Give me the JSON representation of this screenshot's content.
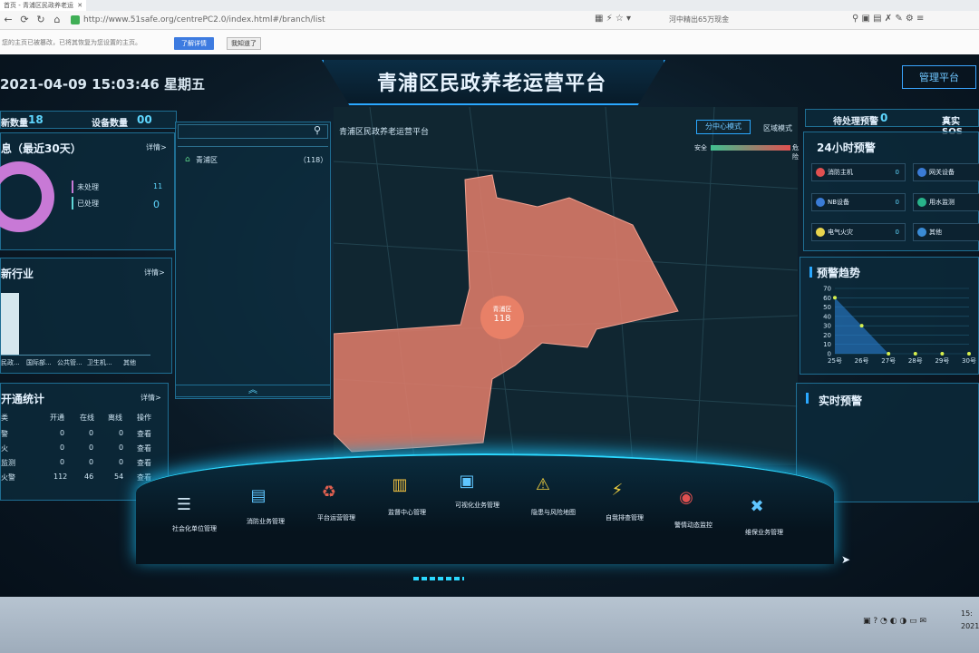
{
  "browser": {
    "tab_title": "首页 - 青浦区民政养老运",
    "tab_close": "✕",
    "url": "http://www.51safe.org/centrePC2.0/index.html#/branch/list",
    "side_search": "河中精出65万现金",
    "notification": "您的主页已被篡改，已将其恢复为您设置的主页。",
    "btn_know": "了解详情",
    "btn_ok": "我知道了"
  },
  "header": {
    "datetime": "2021-04-09 15:03:46 星期五",
    "title": "青浦区民政养老运营平台",
    "mgmt_button": "管理平台"
  },
  "left": {
    "top_stats": {
      "label1": "新数量",
      "value1": "18",
      "label2": "设备数量",
      "value2": "00"
    },
    "alarm_panel": {
      "title": "息（最近30天）",
      "more": "详情>",
      "legend": [
        {
          "label": "未处理",
          "value": "11",
          "color": "#c879d6"
        },
        {
          "label": "已处理",
          "value": "0",
          "color": "#5fd7d7"
        }
      ]
    },
    "industry_panel": {
      "title": "新行业",
      "more": "详情>",
      "categories": [
        "民政...",
        "国际部...",
        "公共管...",
        "卫生机...",
        "其他"
      ]
    },
    "open_panel": {
      "title": "开通统计",
      "more": "详情>",
      "headers": [
        "类",
        "开通",
        "在线",
        "离线",
        "操作"
      ],
      "rows": [
        {
          "name": "警",
          "open": "0",
          "online": "0",
          "offline": "0",
          "op": "查看"
        },
        {
          "name": "火",
          "open": "0",
          "online": "0",
          "offline": "0",
          "op": "查看"
        },
        {
          "name": "监测",
          "open": "0",
          "online": "0",
          "offline": "0",
          "op": "查看"
        },
        {
          "name": "火警",
          "open": "112",
          "online": "46",
          "offline": "54",
          "op": "查看"
        }
      ]
    }
  },
  "search_panel": {
    "placeholder": "",
    "region": "青浦区",
    "count": "（118）"
  },
  "map": {
    "subtitle": "青浦区民政养老运营平台",
    "mode1": "分中心模式",
    "mode2": "区域模式",
    "safe_label": "安全",
    "danger_label": "危险",
    "district_label": "青浦区",
    "district_value": "118"
  },
  "right": {
    "pending_label": "待处理预警",
    "pending_value": "0",
    "realtime_sos": "真实SOS",
    "alert24_title": "24小时预警",
    "alerts": [
      {
        "label": "消防主机",
        "value": "0",
        "color": "#e05050"
      },
      {
        "label": "网关设备",
        "value": "",
        "color": "#3a7bd5"
      },
      {
        "label": "NB设备",
        "value": "0",
        "color": "#3a7bd5"
      },
      {
        "label": "用水监测",
        "value": "",
        "color": "#28b38a"
      },
      {
        "label": "电气火灾",
        "value": "0",
        "color": "#e8d44d"
      },
      {
        "label": "其他",
        "value": "",
        "color": "#3a8bd5"
      }
    ],
    "trend_title": "预警趋势",
    "realtime_title": "实时预警"
  },
  "chart_data": {
    "type": "area",
    "title": "预警趋势",
    "x": [
      "25号",
      "26号",
      "27号",
      "28号",
      "29号",
      "30号"
    ],
    "y_ticks": [
      0,
      10,
      20,
      30,
      40,
      50,
      60,
      70
    ],
    "values": [
      60,
      30,
      0,
      0,
      0,
      0
    ],
    "ylim": [
      0,
      70
    ],
    "color": "#2a7fd0"
  },
  "bottom_nav": [
    {
      "label": "社会化单位管理",
      "icon": "stack-icon"
    },
    {
      "label": "消防业务管理",
      "icon": "document-icon"
    },
    {
      "label": "平台运营管理",
      "icon": "cycle-icon"
    },
    {
      "label": "监督中心管理",
      "icon": "books-icon"
    },
    {
      "label": "可视化业务管理",
      "icon": "monitor-icon"
    },
    {
      "label": "隐患与风险地图",
      "icon": "warning-icon"
    },
    {
      "label": "自我排查管理",
      "icon": "bolt-icon"
    },
    {
      "label": "警情动态监控",
      "icon": "alarm-light-icon"
    },
    {
      "label": "维保业务管理",
      "icon": "tools-icon"
    }
  ],
  "taskbar": {
    "time": "15:",
    "date": "2021/"
  }
}
